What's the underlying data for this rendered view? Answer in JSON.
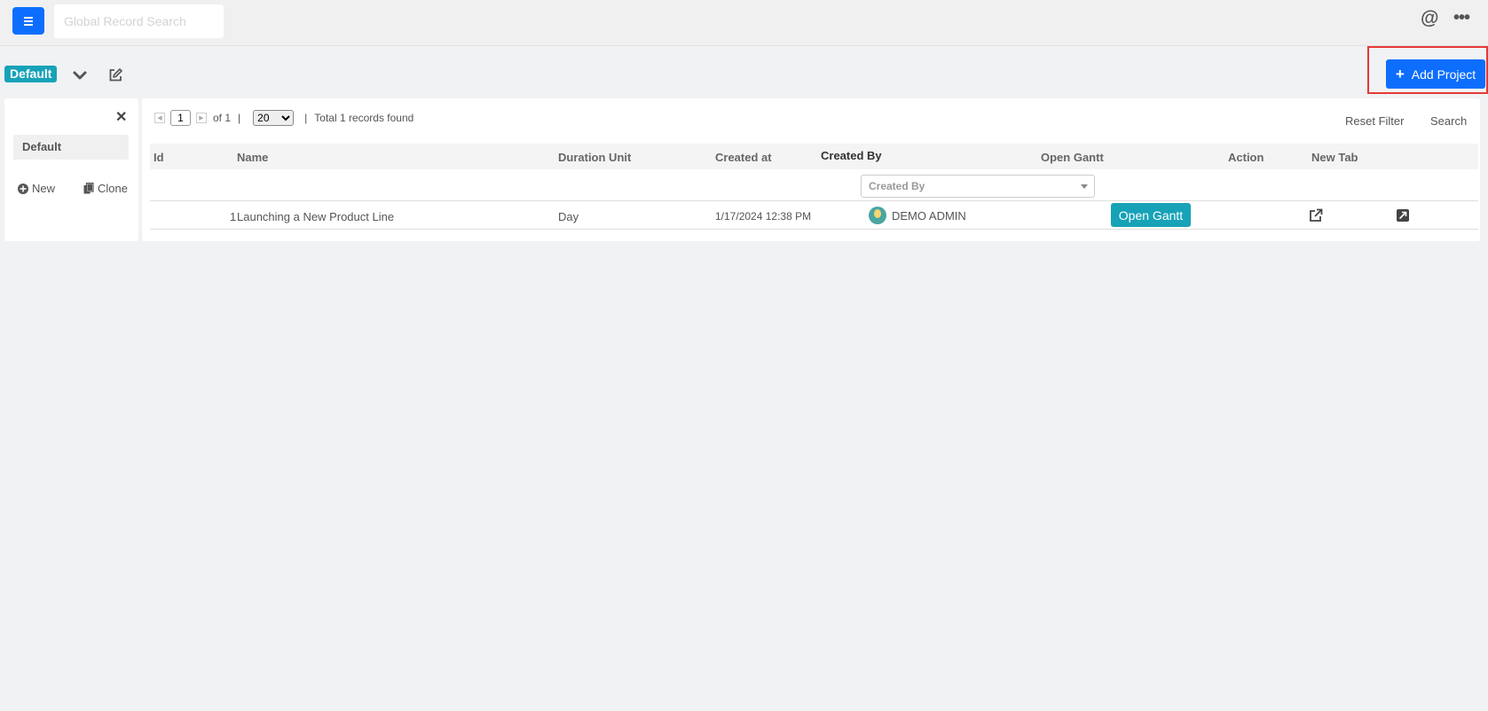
{
  "topbar": {
    "search_placeholder": "Global Record Search",
    "at_symbol": "@",
    "more_symbol": "•••"
  },
  "view": {
    "badge_label": "Default"
  },
  "add_project": {
    "label": "Add Project"
  },
  "left_panel": {
    "close_symbol": "✕",
    "items": [
      {
        "label": "Default"
      }
    ],
    "new_label": "New",
    "clone_label": "Clone"
  },
  "pager": {
    "current_page": "1",
    "of_label": "of 1",
    "page_size": "20",
    "page_size_options": [
      "20"
    ],
    "total_label": "Total 1 records found"
  },
  "toolbar": {
    "reset_filter_label": "Reset Filter",
    "search_label": "Search"
  },
  "table": {
    "columns": [
      "Id",
      "Name",
      "Duration Unit",
      "Created at",
      "Created By",
      "Open Gantt",
      "Action",
      "New Tab"
    ],
    "filter_placeholder": "Created By",
    "rows": [
      {
        "id": "1",
        "name": "Launching a New Product Line",
        "duration_unit": "Day",
        "created_at": "1/17/2024 12:38 PM",
        "created_by": "DEMO ADMIN",
        "open_gantt_label": "Open Gantt"
      }
    ]
  },
  "colors": {
    "primary": "#0d6efd",
    "accent": "#17a2b8",
    "highlight_border": "#e53935"
  }
}
